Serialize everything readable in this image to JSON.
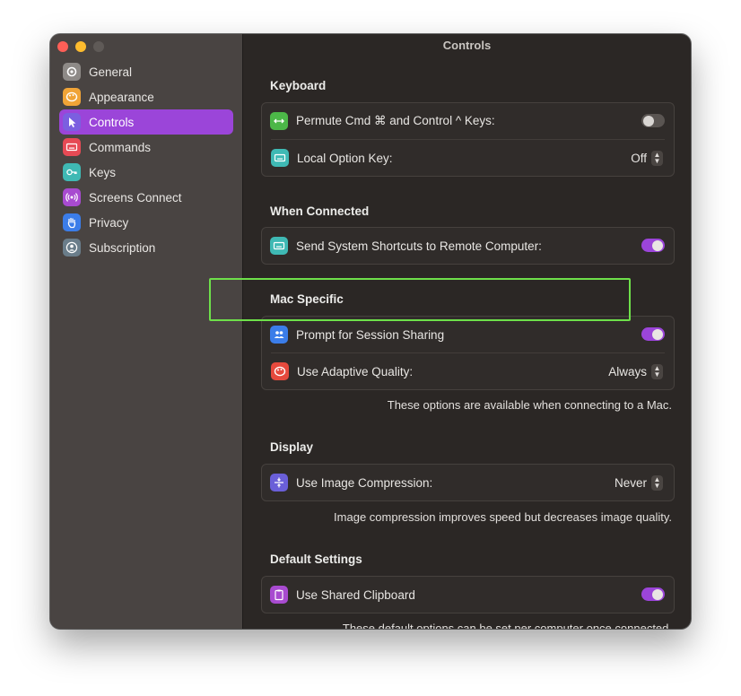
{
  "window": {
    "title": "Controls"
  },
  "sidebar": {
    "items": [
      {
        "label": "General",
        "icon": "gear-icon",
        "color": "#8e8a87"
      },
      {
        "label": "Appearance",
        "icon": "palette-icon",
        "color": "#f0a437"
      },
      {
        "label": "Controls",
        "icon": "cursor-icon",
        "color": "#7b5fe0",
        "active": true
      },
      {
        "label": "Commands",
        "icon": "keyboard-icon",
        "color": "#e64a55"
      },
      {
        "label": "Keys",
        "icon": "key-icon",
        "color": "#3fb9b4"
      },
      {
        "label": "Screens Connect",
        "icon": "broadcast-icon",
        "color": "#a84bd0"
      },
      {
        "label": "Privacy",
        "icon": "hand-icon",
        "color": "#3b7de9"
      },
      {
        "label": "Subscription",
        "icon": "person-icon",
        "color": "#6a7d8a"
      }
    ]
  },
  "sections": {
    "keyboard": {
      "title": "Keyboard",
      "permute_label": "Permute Cmd ⌘ and Control ^ Keys:",
      "permute_on": false,
      "option_label": "Local Option Key:",
      "option_value": "Off"
    },
    "connected": {
      "title": "When Connected",
      "shortcuts_label": "Send System Shortcuts to Remote Computer:",
      "shortcuts_on": true
    },
    "mac": {
      "title": "Mac Specific",
      "session_label": "Prompt for Session Sharing",
      "session_on": true,
      "quality_label": "Use Adaptive Quality:",
      "quality_value": "Always",
      "note": "These options are available when connecting to a Mac."
    },
    "display": {
      "title": "Display",
      "compression_label": "Use Image Compression:",
      "compression_value": "Never",
      "note": "Image compression improves speed but decreases image quality."
    },
    "defaults": {
      "title": "Default Settings",
      "clipboard_label": "Use Shared Clipboard",
      "clipboard_on": true,
      "note": "These default options can be set per computer once connected."
    }
  },
  "colors": {
    "accent": "#9b45d9",
    "highlight": "#6ee04a"
  }
}
